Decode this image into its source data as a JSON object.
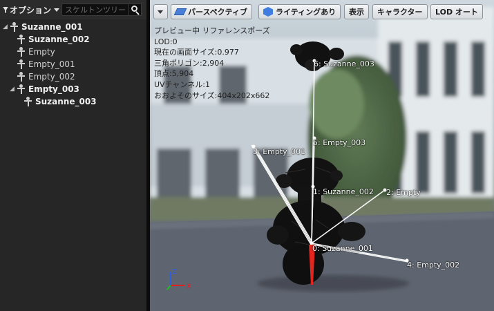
{
  "tree": {
    "options_label": "オプション",
    "search_placeholder": "スケルトンツリーを検索",
    "items": [
      {
        "label": "Suzanne_001",
        "bold": true
      },
      {
        "label": "Suzanne_002",
        "bold": true
      },
      {
        "label": "Empty",
        "bold": false
      },
      {
        "label": "Empty_001",
        "bold": false
      },
      {
        "label": "Empty_002",
        "bold": false
      },
      {
        "label": "Empty_003",
        "bold": true
      },
      {
        "label": "Suzanne_003",
        "bold": true
      }
    ]
  },
  "viewport": {
    "toolbar": {
      "perspective": "パースペクティブ",
      "lighting": "ライティングあり",
      "show": "表示",
      "character": "キャラクター",
      "lod": "LOD オート"
    },
    "stats": [
      "プレビュー中 リファレンスポーズ",
      "LOD:0",
      "現在の画面サイズ:0.977",
      "三角ポリゴン:2,904",
      "頂点:5,904",
      "UVチャンネル:1",
      "おおよそのサイズ:404x202x662"
    ],
    "bone_labels": [
      "6: Suzanne_003",
      "5: Empty_003",
      "3: Empty_001",
      "1: Suzanne_002",
      "2: Empty",
      "0: Suzanne_001",
      "4: Empty_002"
    ],
    "gizmo": {
      "z": "Z",
      "x": "X"
    }
  },
  "colors": {
    "selection_bone": "#e0261f",
    "axis_x": "#e0201c",
    "axis_y": "#1fc21f",
    "axis_z": "#2a5fe0"
  }
}
